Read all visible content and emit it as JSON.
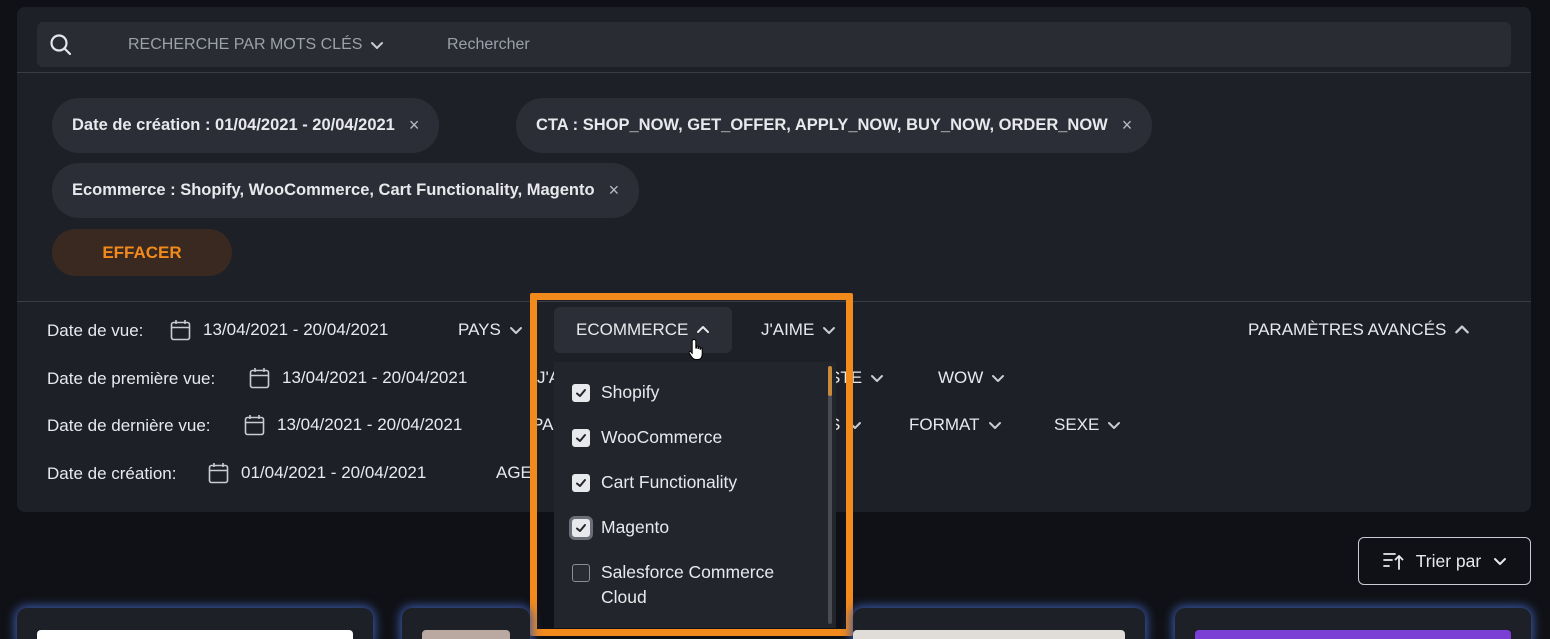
{
  "search": {
    "mode_label": "RECHERCHE PAR MOTS CLÉS",
    "placeholder": "Rechercher"
  },
  "active_filters": [
    {
      "label": "Date de création : 01/04/2021 - 20/04/2021"
    },
    {
      "label": "CTA : SHOP_NOW, GET_OFFER, APPLY_NOW, BUY_NOW, ORDER_NOW"
    },
    {
      "label": "Ecommerce : Shopify, WooCommerce, Cart Functionality, Magento"
    }
  ],
  "close_glyph": "×",
  "clear_label": "EFFACER",
  "rows": [
    {
      "label": "Date de vue:",
      "date": "13/04/2021 - 20/04/2021"
    },
    {
      "label": "Date de première vue:",
      "date": "13/04/2021 - 20/04/2021"
    },
    {
      "label": "Date de dernière vue:",
      "date": "13/04/2021 - 20/04/2021"
    },
    {
      "label": "Date de création:",
      "date": "01/04/2021 - 20/04/2021"
    }
  ],
  "dropdowns": {
    "pays": "PAYS",
    "ecommerce": "ECOMMERCE",
    "jaime_row1": "J'AIME",
    "jaime_row2_partial": "J'A",
    "ste_partial": "STE",
    "wow": "WOW",
    "pa_partial": "PA",
    "s_partial": "S",
    "format": "FORMAT",
    "sexe": "SEXE",
    "age_partial": "AGE",
    "advanced": "PARAMÈTRES AVANCÉS"
  },
  "ecommerce_options": [
    {
      "label": "Shopify",
      "checked": true
    },
    {
      "label": "WooCommerce",
      "checked": true
    },
    {
      "label": "Cart Functionality",
      "checked": true
    },
    {
      "label": "Magento",
      "checked": true
    },
    {
      "label": "Salesforce Commerce Cloud",
      "checked": false
    }
  ],
  "sort_label": "Trier par",
  "colors": {
    "accent_orange": "#f28a1c",
    "panel_bg": "#1e2028",
    "page_bg": "#101116",
    "card_glow": "#3b5aa8",
    "card_purple": "#7b3fd6"
  }
}
